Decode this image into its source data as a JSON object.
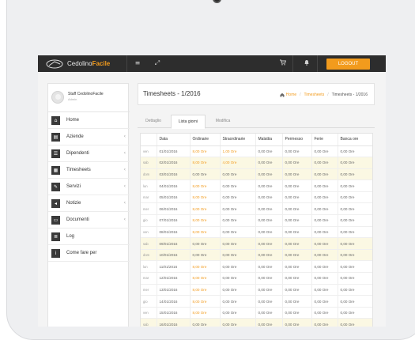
{
  "app": {
    "brand_main": "Cedolino",
    "brand_accent": "Facile",
    "logout_label": "LOGOUT",
    "accent_color": "#f29b1d",
    "topbar_icons": [
      "menu-icon",
      "expand-icon",
      "cart-icon",
      "bell-icon"
    ]
  },
  "profile": {
    "name": "Staff CedolinoFacile",
    "role": "Admin"
  },
  "sidebar": {
    "items": [
      {
        "label": "Home",
        "icon": "home-icon",
        "chevron": ""
      },
      {
        "label": "Aziende",
        "icon": "briefcase-icon",
        "chevron": "‹"
      },
      {
        "label": "Dipendenti",
        "icon": "users-icon",
        "chevron": "‹"
      },
      {
        "label": "Timesheets",
        "icon": "calendar-icon",
        "chevron": "‹"
      },
      {
        "label": "Servizi",
        "icon": "wrench-icon",
        "chevron": "‹"
      },
      {
        "label": "Notizie",
        "icon": "megaphone-icon",
        "chevron": "‹"
      },
      {
        "label": "Documenti",
        "icon": "folder-icon",
        "chevron": "‹"
      },
      {
        "label": "Log",
        "icon": "list-icon",
        "chevron": ""
      },
      {
        "label": "Come fare per",
        "icon": "info-icon",
        "chevron": ""
      }
    ]
  },
  "header": {
    "title": "Timesheets - 1/2016",
    "breadcrumb": {
      "home": "Home",
      "section": "Timesheets",
      "current": "Timesheets - 1/2016"
    }
  },
  "tabs": [
    {
      "label": "Dettaglio",
      "active": false
    },
    {
      "label": "Lista giorni",
      "active": true
    },
    {
      "label": "Modifica",
      "active": false
    }
  ],
  "table": {
    "columns": [
      "",
      "Data",
      "Ordinarie",
      "Straordinarie",
      "Malattia",
      "Permesso",
      "Ferie",
      "Banca ore"
    ],
    "rows": [
      {
        "day": "ven",
        "date": "01/01/2016",
        "ord": "8,00 Ore",
        "str": "1,00 Ore",
        "mal": "0,00 Ore",
        "per": "0,00 Ore",
        "fer": "0,00 Ore",
        "banca": "0,00 Ore",
        "weekend": false
      },
      {
        "day": "sab",
        "date": "02/01/2016",
        "ord": "8,00 Ore",
        "str": "4,00 Ore",
        "mal": "0,00 Ore",
        "per": "0,00 Ore",
        "fer": "0,00 Ore",
        "banca": "0,00 Ore",
        "weekend": true
      },
      {
        "day": "dom",
        "date": "03/01/2016",
        "ord": "0,00 Ore",
        "str": "0,00 Ore",
        "mal": "0,00 Ore",
        "per": "0,00 Ore",
        "fer": "0,00 Ore",
        "banca": "0,00 Ore",
        "weekend": true
      },
      {
        "day": "lun",
        "date": "04/01/2016",
        "ord": "8,00 Ore",
        "str": "0,00 Ore",
        "mal": "0,00 Ore",
        "per": "0,00 Ore",
        "fer": "0,00 Ore",
        "banca": "0,00 Ore",
        "weekend": false
      },
      {
        "day": "mar",
        "date": "05/01/2016",
        "ord": "8,00 Ore",
        "str": "0,00 Ore",
        "mal": "0,00 Ore",
        "per": "0,00 Ore",
        "fer": "0,00 Ore",
        "banca": "0,00 Ore",
        "weekend": false
      },
      {
        "day": "mer",
        "date": "06/01/2016",
        "ord": "8,00 Ore",
        "str": "0,00 Ore",
        "mal": "0,00 Ore",
        "per": "0,00 Ore",
        "fer": "0,00 Ore",
        "banca": "0,00 Ore",
        "weekend": false
      },
      {
        "day": "gio",
        "date": "07/01/2016",
        "ord": "8,00 Ore",
        "str": "0,00 Ore",
        "mal": "0,00 Ore",
        "per": "0,00 Ore",
        "fer": "0,00 Ore",
        "banca": "0,00 Ore",
        "weekend": false
      },
      {
        "day": "ven",
        "date": "08/01/2016",
        "ord": "8,00 Ore",
        "str": "0,00 Ore",
        "mal": "0,00 Ore",
        "per": "0,00 Ore",
        "fer": "0,00 Ore",
        "banca": "0,00 Ore",
        "weekend": false
      },
      {
        "day": "sab",
        "date": "09/01/2016",
        "ord": "0,00 Ore",
        "str": "0,00 Ore",
        "mal": "0,00 Ore",
        "per": "0,00 Ore",
        "fer": "0,00 Ore",
        "banca": "0,00 Ore",
        "weekend": true
      },
      {
        "day": "dom",
        "date": "10/01/2016",
        "ord": "0,00 Ore",
        "str": "0,00 Ore",
        "mal": "0,00 Ore",
        "per": "0,00 Ore",
        "fer": "0,00 Ore",
        "banca": "0,00 Ore",
        "weekend": true
      },
      {
        "day": "lun",
        "date": "11/01/2016",
        "ord": "8,00 Ore",
        "str": "0,00 Ore",
        "mal": "0,00 Ore",
        "per": "0,00 Ore",
        "fer": "0,00 Ore",
        "banca": "0,00 Ore",
        "weekend": false
      },
      {
        "day": "mar",
        "date": "12/01/2016",
        "ord": "8,00 Ore",
        "str": "0,00 Ore",
        "mal": "0,00 Ore",
        "per": "0,00 Ore",
        "fer": "0,00 Ore",
        "banca": "0,00 Ore",
        "weekend": false
      },
      {
        "day": "mer",
        "date": "13/01/2016",
        "ord": "8,00 Ore",
        "str": "0,00 Ore",
        "mal": "0,00 Ore",
        "per": "0,00 Ore",
        "fer": "0,00 Ore",
        "banca": "0,00 Ore",
        "weekend": false
      },
      {
        "day": "gio",
        "date": "14/01/2016",
        "ord": "8,00 Ore",
        "str": "0,00 Ore",
        "mal": "0,00 Ore",
        "per": "0,00 Ore",
        "fer": "0,00 Ore",
        "banca": "0,00 Ore",
        "weekend": false
      },
      {
        "day": "ven",
        "date": "15/01/2016",
        "ord": "8,00 Ore",
        "str": "0,00 Ore",
        "mal": "0,00 Ore",
        "per": "0,00 Ore",
        "fer": "0,00 Ore",
        "banca": "0,00 Ore",
        "weekend": false
      },
      {
        "day": "sab",
        "date": "16/01/2016",
        "ord": "0,00 Ore",
        "str": "0,00 Ore",
        "mal": "0,00 Ore",
        "per": "0,00 Ore",
        "fer": "0,00 Ore",
        "banca": "0,00 Ore",
        "weekend": true
      }
    ]
  }
}
